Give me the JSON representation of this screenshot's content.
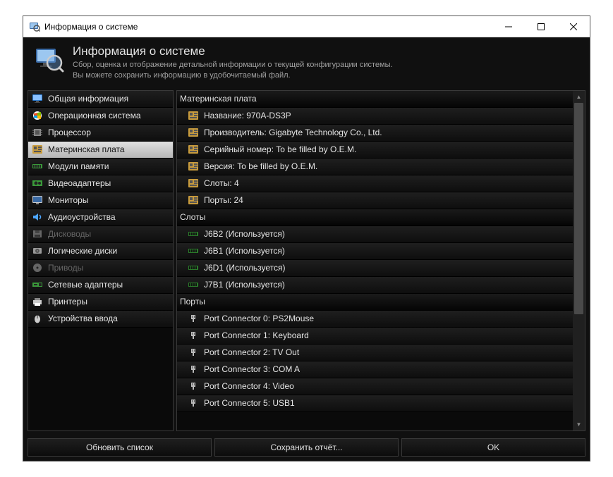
{
  "window": {
    "title": "Информация о системе"
  },
  "header": {
    "title": "Информация о системе",
    "line1": "Сбор, оценка и отображение детальной информации о текущей конфигурации системы.",
    "line2": "Вы можете сохранить информацию в удобочитаемый файл."
  },
  "sidebar": {
    "items": [
      {
        "id": "general",
        "label": "Общая информация",
        "icon": "monitor",
        "color": "#2d7dd2"
      },
      {
        "id": "os",
        "label": "Операционная система",
        "icon": "windows",
        "color": "#e04040"
      },
      {
        "id": "cpu",
        "label": "Процессор",
        "icon": "chip",
        "color": "#888"
      },
      {
        "id": "motherboard",
        "label": "Материнская плата",
        "icon": "board",
        "color": "#c89b3c",
        "selected": true
      },
      {
        "id": "memory",
        "label": "Модули памяти",
        "icon": "ram",
        "color": "#3a9a3a"
      },
      {
        "id": "video",
        "label": "Видеоадаптеры",
        "icon": "gpu",
        "color": "#3a9a3a"
      },
      {
        "id": "monitors",
        "label": "Мониторы",
        "icon": "monitor2",
        "color": "#ccc"
      },
      {
        "id": "audio",
        "label": "Аудиоустройства",
        "icon": "speaker",
        "color": "#4da6ff"
      },
      {
        "id": "floppy",
        "label": "Дисководы",
        "icon": "floppy",
        "color": "#666",
        "disabled": true
      },
      {
        "id": "disks",
        "label": "Логические диски",
        "icon": "hdd",
        "color": "#999"
      },
      {
        "id": "optical",
        "label": "Приводы",
        "icon": "cd",
        "color": "#666",
        "disabled": true
      },
      {
        "id": "network",
        "label": "Сетевые адаптеры",
        "icon": "nic",
        "color": "#3a9a3a"
      },
      {
        "id": "printers",
        "label": "Принтеры",
        "icon": "printer",
        "color": "#ccc"
      },
      {
        "id": "input",
        "label": "Устройства ввода",
        "icon": "mouse",
        "color": "#ccc"
      }
    ]
  },
  "content": {
    "groups": [
      {
        "title": "Материнская плата",
        "rows": [
          {
            "icon": "board",
            "label": "Название: 970A-DS3P"
          },
          {
            "icon": "board",
            "label": "Производитель: Gigabyte Technology Co., Ltd."
          },
          {
            "icon": "board",
            "label": "Серийный номер: To be filled by O.E.M."
          },
          {
            "icon": "board",
            "label": "Версия: To be filled by O.E.M."
          },
          {
            "icon": "board",
            "label": "Слоты: 4"
          },
          {
            "icon": "board",
            "label": "Порты: 24"
          }
        ]
      },
      {
        "title": "Слоты",
        "rows": [
          {
            "icon": "slot",
            "label": "J6B2 (Используется)"
          },
          {
            "icon": "slot",
            "label": "J6B1 (Используется)"
          },
          {
            "icon": "slot",
            "label": "J6D1 (Используется)"
          },
          {
            "icon": "slot",
            "label": "J7B1 (Используется)"
          }
        ]
      },
      {
        "title": "Порты",
        "rows": [
          {
            "icon": "port",
            "label": "Port Connector 0: PS2Mouse"
          },
          {
            "icon": "port",
            "label": "Port Connector 1: Keyboard"
          },
          {
            "icon": "port",
            "label": "Port Connector 2: TV Out"
          },
          {
            "icon": "port",
            "label": "Port Connector 3: COM A"
          },
          {
            "icon": "port",
            "label": "Port Connector 4: Video"
          },
          {
            "icon": "port",
            "label": "Port Connector 5: USB1"
          }
        ]
      }
    ]
  },
  "footer": {
    "refresh": "Обновить список",
    "save": "Сохранить отчёт...",
    "ok": "OK"
  }
}
